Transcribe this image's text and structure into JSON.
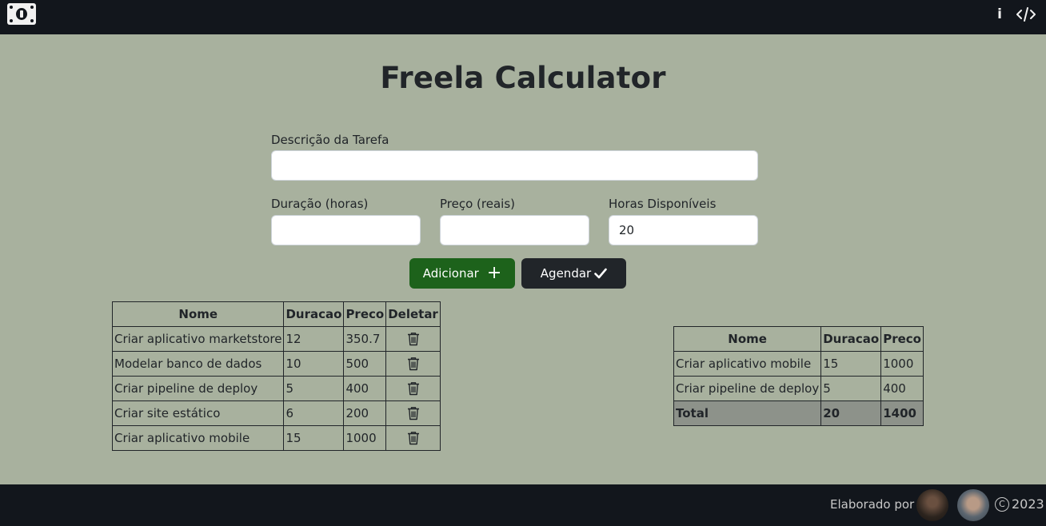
{
  "nav": {
    "logo_icon": "money-bill-icon",
    "info_icon": "info-icon",
    "info_label": "i",
    "code_icon": "code-icon"
  },
  "page": {
    "title": "Freela Calculator"
  },
  "form": {
    "description_label": "Descrição da Tarefa",
    "description_value": "",
    "duration_label": "Duração (horas)",
    "duration_value": "",
    "price_label": "Preço (reais)",
    "price_value": "",
    "hours_label": "Horas Disponíveis",
    "hours_value": "20",
    "add_label": "Adicionar",
    "add_icon": "plus-icon",
    "add_icon_glyph": "+",
    "schedule_label": "Agendar",
    "schedule_icon": "check-icon",
    "add_color": "#1d621b",
    "schedule_color": "#212529"
  },
  "tasks_table": {
    "headers": [
      "Nome",
      "Duracao",
      "Preco",
      "Deletar"
    ],
    "rows": [
      {
        "nome": "Criar aplicativo marketstore",
        "duracao": "12",
        "preco": "350.7"
      },
      {
        "nome": "Modelar banco de dados",
        "duracao": "10",
        "preco": "500"
      },
      {
        "nome": "Criar pipeline de deploy",
        "duracao": "5",
        "preco": "400"
      },
      {
        "nome": "Criar site estático",
        "duracao": "6",
        "preco": "200"
      },
      {
        "nome": "Criar aplicativo mobile",
        "duracao": "15",
        "preco": "1000"
      }
    ],
    "delete_icon": "trash-icon"
  },
  "schedule_table": {
    "headers": [
      "Nome",
      "Duracao",
      "Preco"
    ],
    "rows": [
      {
        "nome": "Criar aplicativo mobile",
        "duracao": "15",
        "preco": "1000"
      },
      {
        "nome": "Criar pipeline de deploy",
        "duracao": "5",
        "preco": "400"
      }
    ],
    "total": {
      "label": "Total",
      "duracao": "20",
      "preco": "1400"
    }
  },
  "footer": {
    "by_label": "Elaborado por",
    "copyright_symbol": "C",
    "year": "2023"
  },
  "colors": {
    "background": "#a8b19e",
    "navbar": "#12161c",
    "total_row": "#8d928a"
  }
}
